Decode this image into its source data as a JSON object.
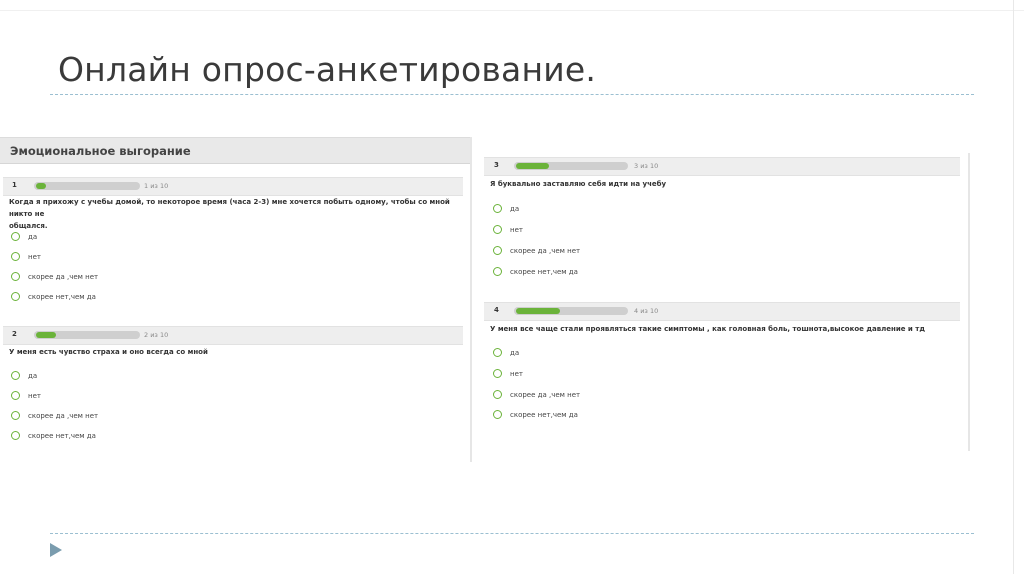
{
  "slide": {
    "title": "Онлайн опрос-анкетирование."
  },
  "survey": {
    "title": "Эмоциональное выгорание",
    "questions": [
      {
        "number": "1",
        "count": "1 из 10",
        "progress": 0.1,
        "text_line1": "Когда я прихожу с учебы домой, то некоторое время (часа 2-3) мне хочется побыть одному, чтобы со мной никто не",
        "text_line2": "общался.",
        "options": [
          "да",
          "нет",
          "скорее да ,чем нет",
          "скорее нет,чем да"
        ]
      },
      {
        "number": "2",
        "count": "2 из 10",
        "progress": 0.2,
        "text_line1": "У меня есть чувство страха и оно всегда со мной",
        "options": [
          "да",
          "нет",
          "скорее да ,чем нет",
          "скорее нет,чем да"
        ]
      },
      {
        "number": "3",
        "count": "3 из 10",
        "progress": 0.3,
        "text_line1": "Я буквально заставляю себя идти на учебу",
        "options": [
          "да",
          "нет",
          "скорее да ,чем нет",
          "скорее нет,чем да"
        ]
      },
      {
        "number": "4",
        "count": "4 из 10",
        "progress": 0.4,
        "text_line1": "У меня все чаще стали проявляться такие симптомы , как головная боль, тошнота,высокое давление и тд",
        "options": [
          "да",
          "нет",
          "скорее да ,чем нет",
          "скорее нет,чем да"
        ]
      }
    ]
  },
  "colors": {
    "accent_green": "#6bb33a",
    "rule_blue": "#9bbfd1",
    "play_icon": "#7a9cae"
  }
}
